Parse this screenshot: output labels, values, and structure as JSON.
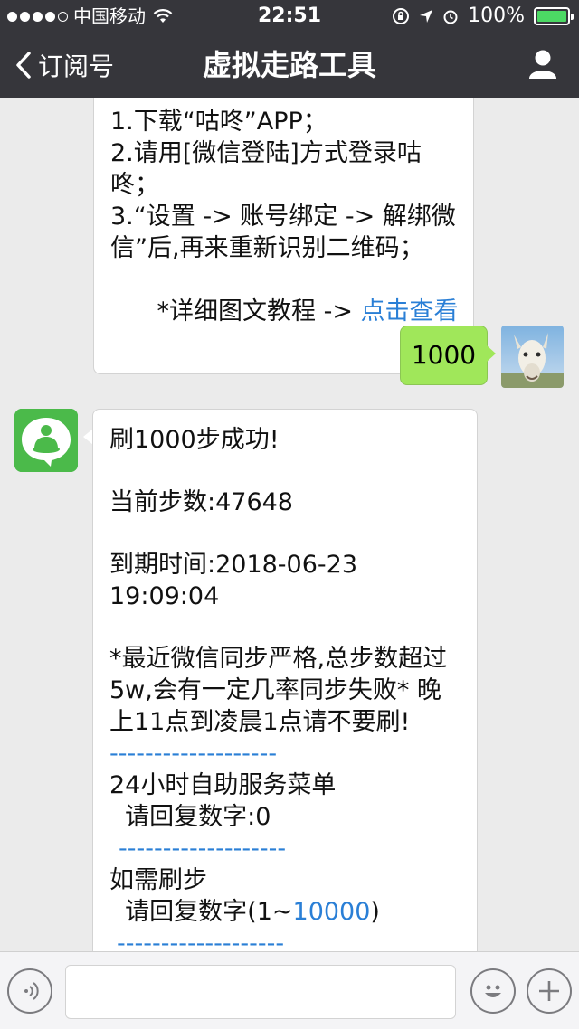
{
  "status_bar": {
    "carrier": "中国移动",
    "time": "22:51",
    "battery": "100%",
    "battery_level": 1.0
  },
  "nav": {
    "back_label": "订阅号",
    "title": "虚拟走路工具"
  },
  "messages": {
    "instructions": {
      "line1": "1.下载“咕咚”APP；",
      "line2": "2.请用[微信登陆]方式登录咕咚；",
      "line3": "3.“设置 -> 账号绑定 -> 解绑微信”后,再来重新识别二维码；",
      "line4_prefix": "*详细图文教程 -> ",
      "line4_link": "点击查看"
    },
    "sent": {
      "text": "1000"
    },
    "reply": {
      "line1": "刷1000步成功!",
      "line2": "当前步数:47648",
      "line3": "到期时间:2018-06-23 19:09:04",
      "line4": "*最近微信同步严格,总步数超过5w,会有一定几率同步失败* 晚上11点到凌晨1点请不要刷!",
      "dashes": "-------------------",
      "menu_title": "24小时自助服务菜单",
      "menu_reply": "  请回复数字:0",
      "step_title": "如需刷步",
      "step_reply_prefix": "  请回复数字(1~",
      "step_reply_max": "10000",
      "step_reply_suffix": ")"
    }
  },
  "colors": {
    "nav_bg": "#36363b",
    "chat_bg": "#ebebeb",
    "sent_bubble": "#a0e75a",
    "link": "#2a7fd6",
    "battery": "#4cd964"
  },
  "icons": {
    "back": "chevron-left-icon",
    "user": "person-icon",
    "voice": "voice-icon",
    "emoji": "emoji-icon",
    "plus": "plus-icon"
  }
}
